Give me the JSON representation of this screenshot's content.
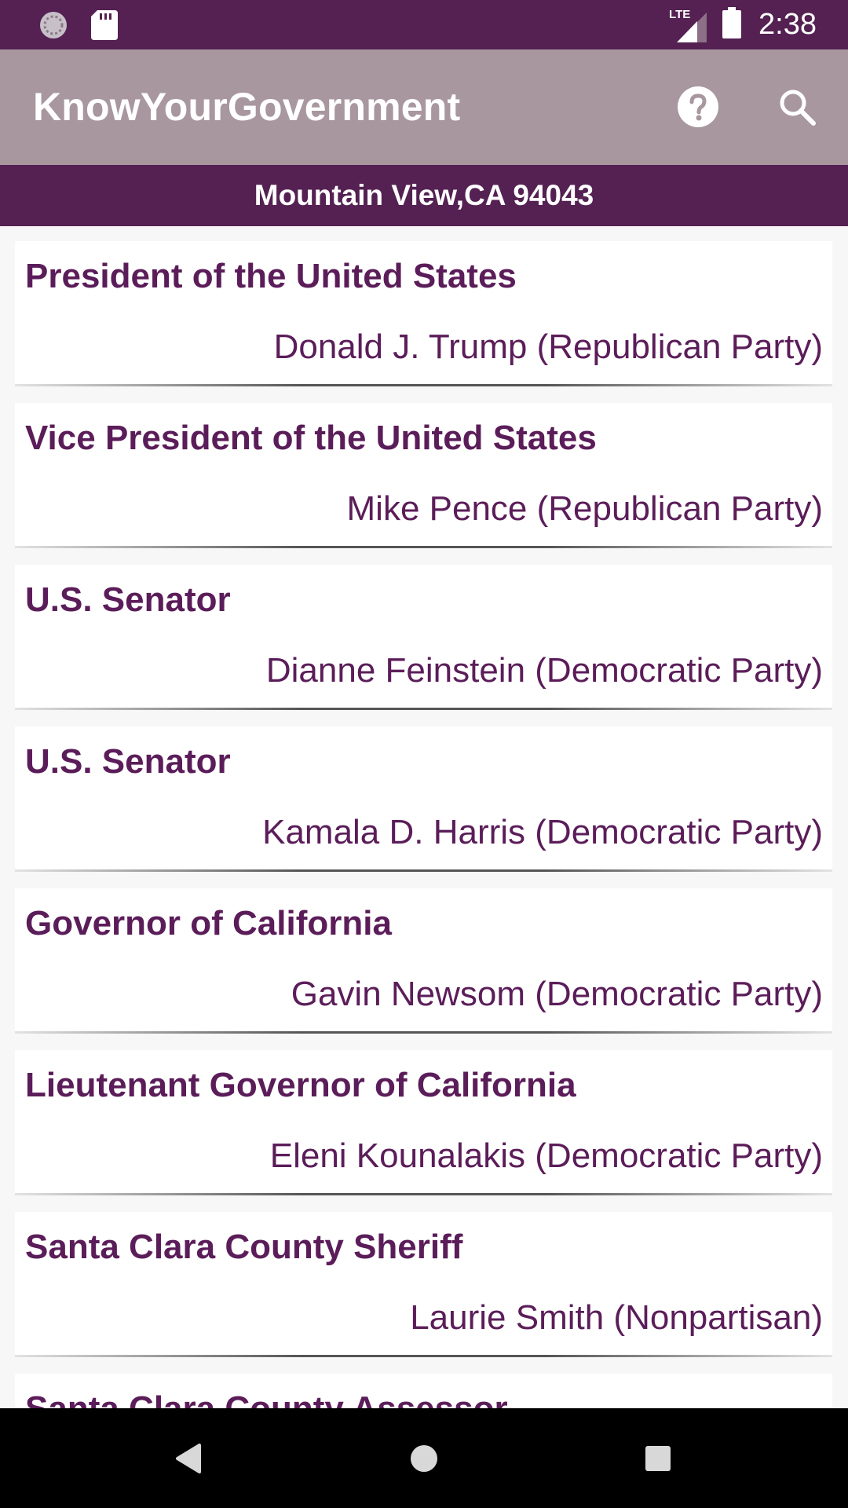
{
  "status_bar": {
    "network_label": "LTE",
    "time": "2:38",
    "icons": [
      "sync-icon",
      "sd-card-icon",
      "signal-icon",
      "battery-icon"
    ]
  },
  "app_bar": {
    "title": "KnowYourGovernment",
    "actions": [
      "help-icon",
      "search-icon"
    ]
  },
  "location": "Mountain View,CA 94043",
  "officials": [
    {
      "office": "President of the United States",
      "name": "Donald J. Trump (Republican Party)"
    },
    {
      "office": "Vice President of the United States",
      "name": "Mike Pence (Republican Party)"
    },
    {
      "office": "U.S. Senator",
      "name": "Dianne Feinstein (Democratic Party)"
    },
    {
      "office": "U.S. Senator",
      "name": "Kamala D. Harris (Democratic Party)"
    },
    {
      "office": "Governor of California",
      "name": "Gavin Newsom (Democratic Party)"
    },
    {
      "office": "Lieutenant Governor of California",
      "name": "Eleni Kounalakis (Democratic Party)"
    },
    {
      "office": "Santa Clara County Sheriff",
      "name": "Laurie Smith (Nonpartisan)"
    },
    {
      "office": "Santa Clara County Assessor",
      "name": ""
    }
  ],
  "colors": {
    "primary_dark": "#542152",
    "primary": "#a8979f",
    "text": "#5b1d59"
  },
  "nav_bar": {
    "buttons": [
      "back-icon",
      "home-icon",
      "recents-icon"
    ]
  }
}
